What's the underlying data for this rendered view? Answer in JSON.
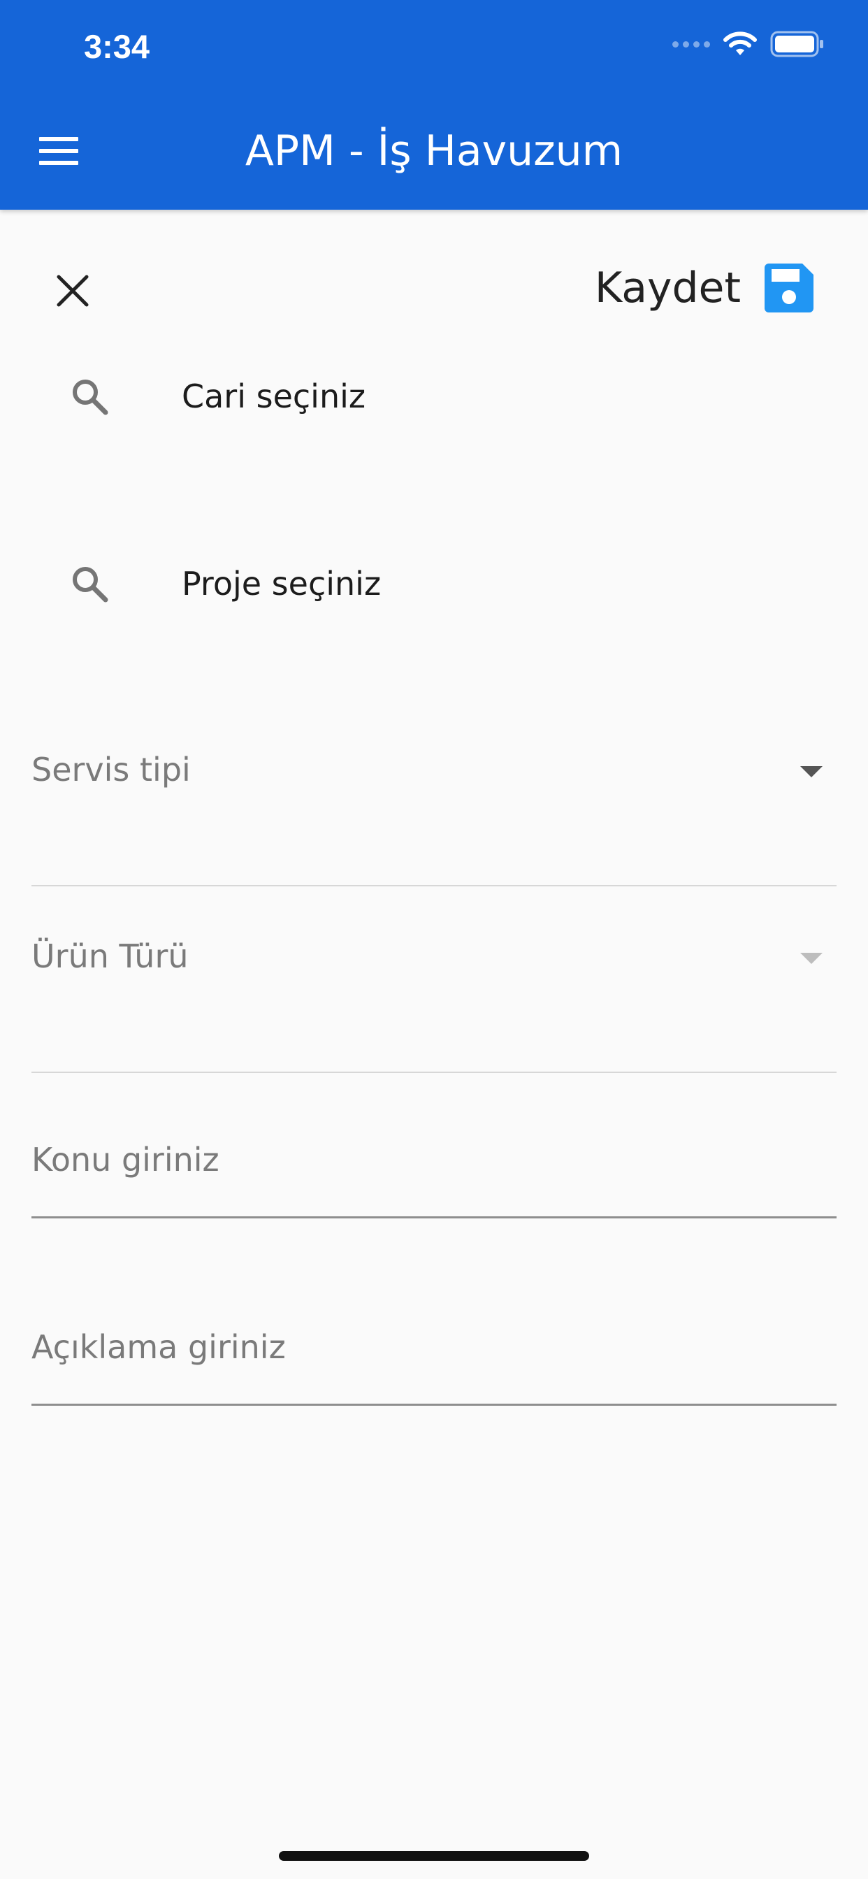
{
  "status_bar": {
    "time": "3:34"
  },
  "header": {
    "title": "APM - İş Havuzum",
    "background_color": "#1565d8"
  },
  "toolbar": {
    "save_label": "Kaydet",
    "save_icon": "floppy-disk-icon",
    "close_icon": "close-icon",
    "accent_color": "#2196f3"
  },
  "form": {
    "customer_search": {
      "icon": "search-icon",
      "text": "Cari seçiniz"
    },
    "project_search": {
      "icon": "search-icon",
      "text": "Proje seçiniz"
    },
    "service_type": {
      "label": "Servis tipi"
    },
    "product_type": {
      "label": "Ürün Türü"
    },
    "subject": {
      "placeholder": "Konu giriniz"
    },
    "description": {
      "placeholder": "Açıklama giriniz"
    }
  }
}
